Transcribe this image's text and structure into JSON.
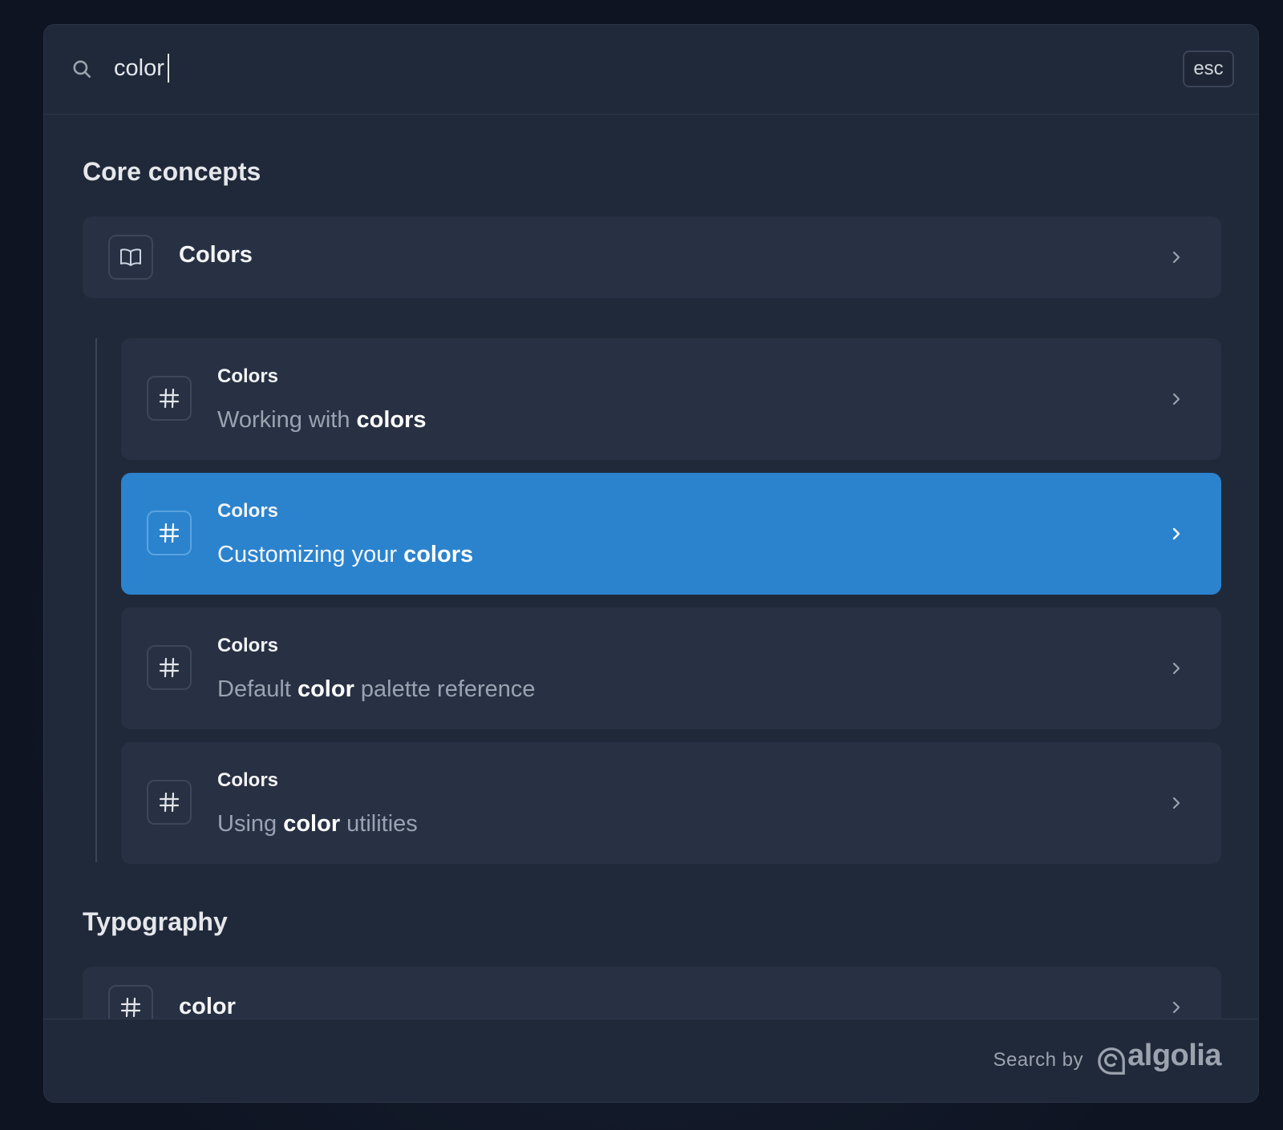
{
  "search": {
    "value": "color",
    "esc_label": "esc"
  },
  "sections": [
    {
      "title": "Core concepts",
      "items": [
        {
          "icon": "book-icon",
          "title": "Colors"
        },
        {
          "icon": "hash-icon",
          "title": "Colors",
          "text_pre": "Working with ",
          "text_match": "colors",
          "text_post": ""
        },
        {
          "icon": "hash-icon",
          "title": "Colors",
          "text_pre": "Customizing your ",
          "text_match": "colors",
          "text_post": "",
          "selected": true
        },
        {
          "icon": "hash-icon",
          "title": "Colors",
          "text_pre": "Default ",
          "text_match": "color",
          "text_post": " palette reference"
        },
        {
          "icon": "hash-icon",
          "title": "Colors",
          "text_pre": "Using ",
          "text_match": "color",
          "text_post": " utilities"
        }
      ]
    },
    {
      "title": "Typography",
      "items": [
        {
          "icon": "hash-icon",
          "title": "color"
        }
      ]
    }
  ],
  "footer": {
    "search_by": "Search by",
    "brand": "algolia"
  },
  "colors": {
    "selected": "#2b83cd",
    "item_bg": "#283143",
    "modal_bg": "#202939"
  }
}
